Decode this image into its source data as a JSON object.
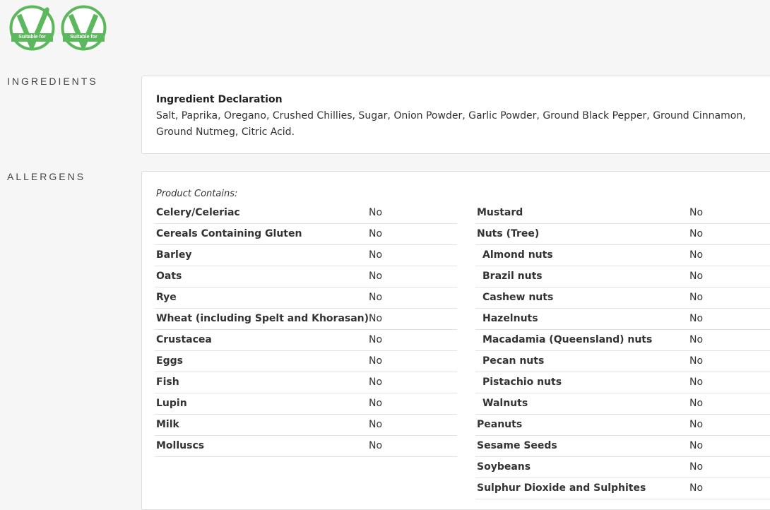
{
  "badges": [
    {
      "text": "Suitable for",
      "icon": "vegetarian-v-icon",
      "color": "#5cb85c"
    },
    {
      "text": "Suitable for",
      "icon": "vegan-v-icon",
      "color": "#5cb85c"
    }
  ],
  "ingredients": {
    "label": "INGREDIENTS",
    "title": "Ingredient Declaration",
    "text": "Salt, Paprika, Oregano, Crushed Chillies, Sugar, Onion Powder, Garlic Powder, Ground Black Pepper, Ground Cinnamon, Ground Nutmeg, Citric Acid."
  },
  "allergens": {
    "label": "ALLERGENS",
    "contains_label": "Product Contains:",
    "left": [
      {
        "name": "Celery/Celeriac",
        "value": "No"
      },
      {
        "name": "Cereals Containing Gluten",
        "value": "No"
      },
      {
        "name": "Barley",
        "value": "No"
      },
      {
        "name": "Oats",
        "value": "No"
      },
      {
        "name": "Rye",
        "value": "No"
      },
      {
        "name": "Wheat (including Spelt and Khorasan)",
        "value": "No"
      },
      {
        "name": "Crustacea",
        "value": "No"
      },
      {
        "name": "Eggs",
        "value": "No"
      },
      {
        "name": "Fish",
        "value": "No"
      },
      {
        "name": "Lupin",
        "value": "No"
      },
      {
        "name": "Milk",
        "value": "No"
      },
      {
        "name": "Molluscs",
        "value": "No"
      }
    ],
    "right": [
      {
        "name": "Mustard",
        "value": "No",
        "sub": false
      },
      {
        "name": "Nuts (Tree)",
        "value": "No",
        "sub": false
      },
      {
        "name": "Almond nuts",
        "value": "No",
        "sub": true
      },
      {
        "name": "Brazil nuts",
        "value": "No",
        "sub": true
      },
      {
        "name": "Cashew nuts",
        "value": "No",
        "sub": true
      },
      {
        "name": "Hazelnuts",
        "value": "No",
        "sub": true
      },
      {
        "name": "Macadamia (Queensland) nuts",
        "value": "No",
        "sub": true
      },
      {
        "name": "Pecan nuts",
        "value": "No",
        "sub": true
      },
      {
        "name": "Pistachio nuts",
        "value": "No",
        "sub": true
      },
      {
        "name": "Walnuts",
        "value": "No",
        "sub": true
      },
      {
        "name": "Peanuts",
        "value": "No",
        "sub": false
      },
      {
        "name": "Sesame Seeds",
        "value": "No",
        "sub": false
      },
      {
        "name": "Soybeans",
        "value": "No",
        "sub": false
      },
      {
        "name": "Sulphur Dioxide and Sulphites",
        "value": "No",
        "sub": false
      }
    ]
  }
}
